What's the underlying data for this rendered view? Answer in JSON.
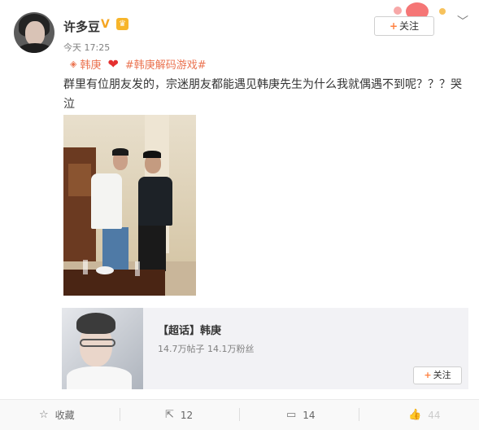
{
  "post": {
    "username": "许多豆",
    "verified_mark": "V",
    "vip_mark": "♛",
    "time": "今天 17:25",
    "follow_label": "关注",
    "tag_name": "韩庚",
    "topic": "#韩庚解码游戏#",
    "text": "群里有位朋友发的，宗迷朋友都能遇见韩庚先生为什么我就偶遇不到呢？？？哭泣"
  },
  "supertopic": {
    "title": "【超话】韩庚",
    "posts": "14.7万帖子",
    "fans": "14.1万粉丝",
    "follow_label": "关注"
  },
  "actions": {
    "favorite_label": "收藏",
    "repost_count": "12",
    "comment_count": "14",
    "like_count": "44"
  },
  "icons": [
    "avatar-icon",
    "verified-icon",
    "vip-icon",
    "plus-icon",
    "chevron-down-icon",
    "supertopic-icon",
    "heart-icon",
    "cry-emoji",
    "star-icon",
    "repost-icon",
    "comment-icon",
    "like-icon"
  ],
  "colors": {
    "accent": "#eb7350",
    "plus": "#ff8140",
    "heart": "#e5302f",
    "verified": "#f5a623"
  }
}
